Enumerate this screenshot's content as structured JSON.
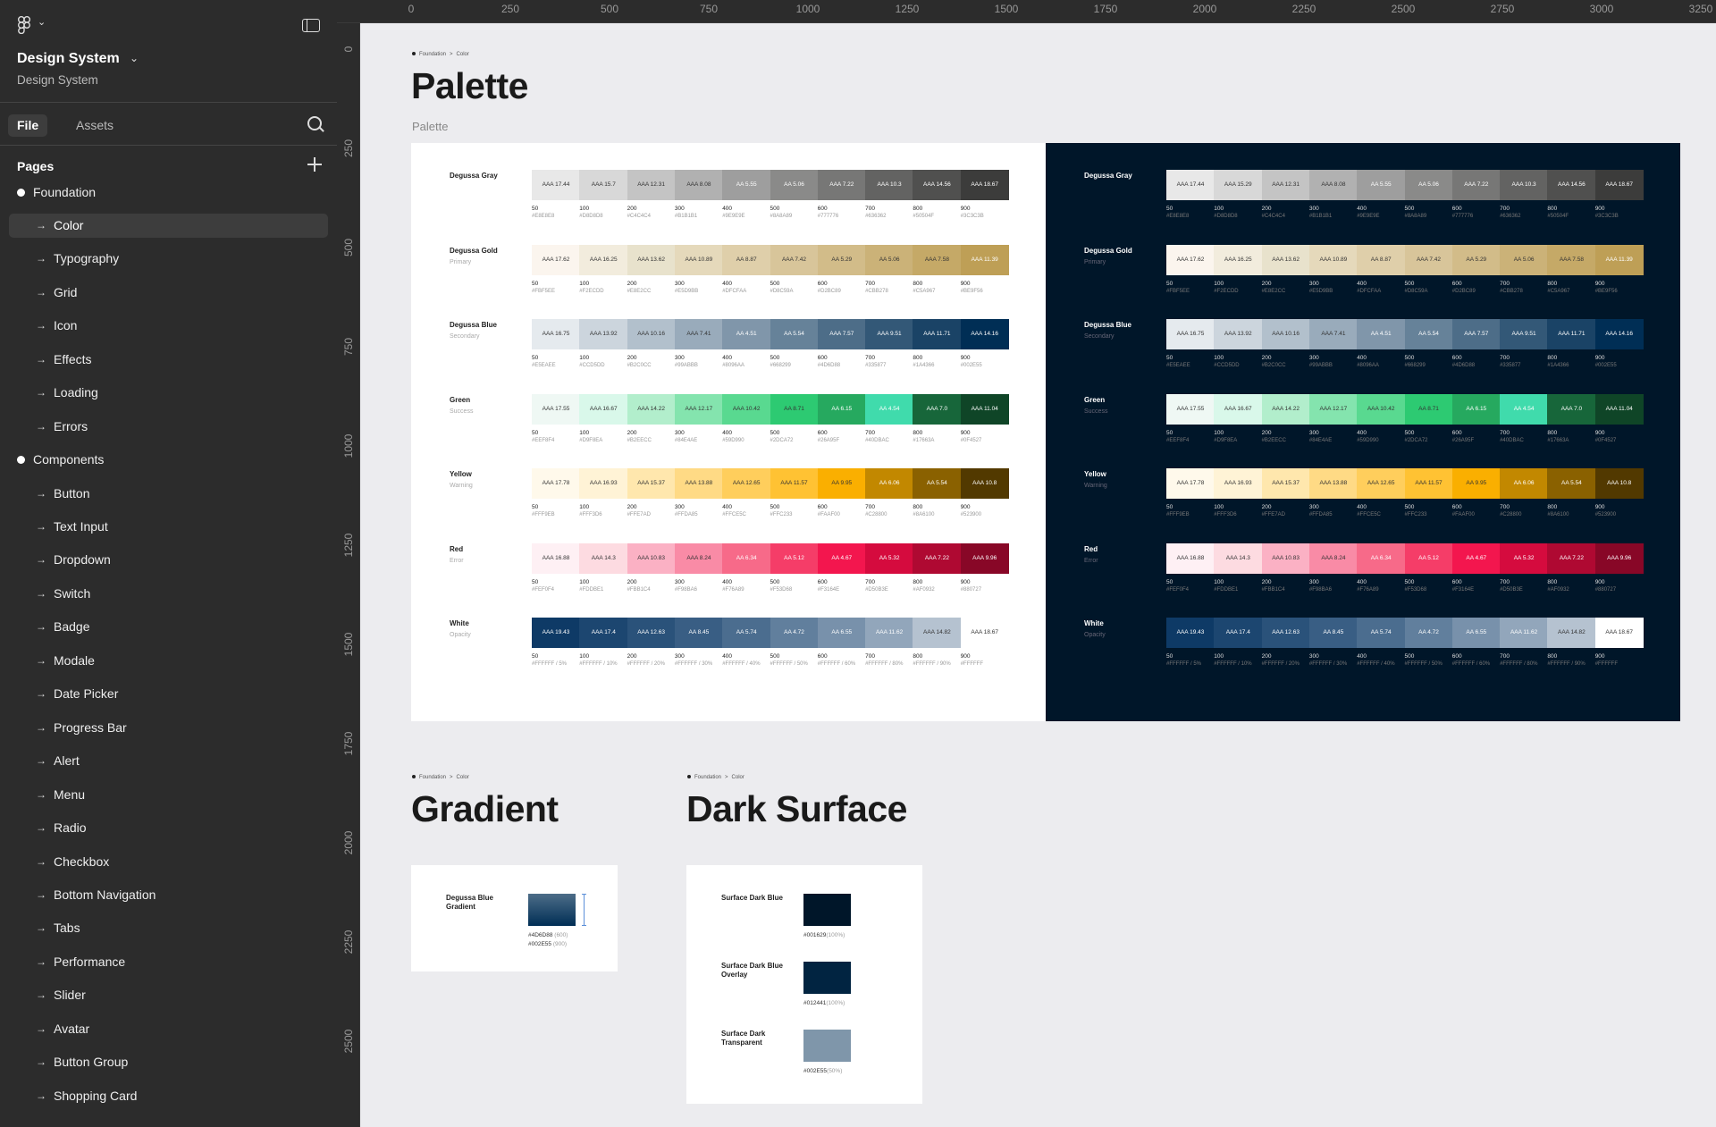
{
  "sidebar": {
    "file_title": "Design System",
    "file_subtitle": "Design System",
    "tabs": [
      "File",
      "Assets"
    ],
    "pages_heading": "Pages",
    "pages": [
      {
        "label": "Foundation",
        "type": "section"
      },
      {
        "label": "Color",
        "type": "page",
        "selected": true
      },
      {
        "label": "Typography",
        "type": "page"
      },
      {
        "label": "Grid",
        "type": "page"
      },
      {
        "label": "Icon",
        "type": "page"
      },
      {
        "label": "Effects",
        "type": "page"
      },
      {
        "label": "Loading",
        "type": "page"
      },
      {
        "label": "Errors",
        "type": "page"
      },
      {
        "label": "Components",
        "type": "section"
      },
      {
        "label": "Button",
        "type": "page"
      },
      {
        "label": "Text Input",
        "type": "page"
      },
      {
        "label": "Dropdown",
        "type": "page"
      },
      {
        "label": "Switch",
        "type": "page"
      },
      {
        "label": "Badge",
        "type": "page"
      },
      {
        "label": "Modale",
        "type": "page"
      },
      {
        "label": "Date Picker",
        "type": "page"
      },
      {
        "label": "Progress Bar",
        "type": "page"
      },
      {
        "label": "Alert",
        "type": "page"
      },
      {
        "label": "Menu",
        "type": "page"
      },
      {
        "label": "Radio",
        "type": "page"
      },
      {
        "label": "Checkbox",
        "type": "page"
      },
      {
        "label": "Bottom Navigation",
        "type": "page"
      },
      {
        "label": "Tabs",
        "type": "page"
      },
      {
        "label": "Performance",
        "type": "page"
      },
      {
        "label": "Slider",
        "type": "page"
      },
      {
        "label": "Avatar",
        "type": "page"
      },
      {
        "label": "Button Group",
        "type": "page"
      },
      {
        "label": "Shopping Card",
        "type": "page"
      }
    ]
  },
  "rulers": {
    "top": [
      "0",
      "250",
      "500",
      "750",
      "1000",
      "1250",
      "1500",
      "1750",
      "2000",
      "2250",
      "2500",
      "2750",
      "3000",
      "3250"
    ],
    "left": [
      "0",
      "250",
      "500",
      "750",
      "1000",
      "1250",
      "1500",
      "1750",
      "2000",
      "2250",
      "2500"
    ]
  },
  "breadcrumb": {
    "section": "Foundation",
    "page": "Color"
  },
  "palette_section": {
    "title": "Palette",
    "frame_label": "Palette"
  },
  "steps": [
    "50",
    "100",
    "200",
    "300",
    "400",
    "500",
    "600",
    "700",
    "800",
    "900"
  ],
  "palette_rows": [
    {
      "name": "Degussa Gray",
      "sub": "",
      "light": {
        "colors": [
          "#E8E8E8",
          "#D8D8D8",
          "#C4C4C4",
          "#B1B1B1",
          "#9E9E9E",
          "#8A8A89",
          "#777776",
          "#636362",
          "#50504F",
          "#3C3C3B"
        ],
        "labels": [
          "AAA 17.44",
          "AAA 15.7",
          "AAA 12.31",
          "AAA 8.08",
          "AA 5.55",
          "AA 5.06",
          "AAA 7.22",
          "AAA 10.3",
          "AAA 14.56",
          "AAA 18.67"
        ],
        "text_colors": [
          "#333",
          "#333",
          "#333",
          "#333",
          "#fff",
          "#fff",
          "#fff",
          "#fff",
          "#fff",
          "#fff"
        ],
        "hexes": [
          "#E8E8E8",
          "#D8D8D8",
          "#C4C4C4",
          "#B1B1B1",
          "#9E9E9E",
          "#8A8A89",
          "#777776",
          "#636362",
          "#50504F",
          "#3C3C3B"
        ]
      },
      "dark": {
        "colors": [
          "#E8E8E8",
          "#D8D8D8",
          "#C4C4C4",
          "#B1B1B1",
          "#9E9E9E",
          "#8A8A89",
          "#777776",
          "#636362",
          "#50504F",
          "#3C3C3B"
        ],
        "labels": [
          "AAA 17.44",
          "AAA 15.29",
          "AAA 12.31",
          "AAA 8.08",
          "AA 5.55",
          "AA 5.06",
          "AAA 7.22",
          "AAA 10.3",
          "AAA 14.56",
          "AAA 18.67"
        ],
        "text_colors": [
          "#333",
          "#333",
          "#333",
          "#333",
          "#fff",
          "#fff",
          "#fff",
          "#fff",
          "#fff",
          "#fff"
        ],
        "hexes": [
          "#E8E8E8",
          "#D8D8D8",
          "#C4C4C4",
          "#B1B1B1",
          "#9E9E9E",
          "#8A8A89",
          "#777776",
          "#636362",
          "#50504F",
          "#3C3C3B"
        ]
      }
    },
    {
      "name": "Degussa Gold",
      "sub": "Primary",
      "light": {
        "colors": [
          "#FBF5EE",
          "#F2ECDD",
          "#E8E2CC",
          "#E5D9BB",
          "#DFCFAA",
          "#D8C59A",
          "#D2BC89",
          "#CBB278",
          "#C5A967",
          "#BE9F56"
        ],
        "labels": [
          "AAA 17.62",
          "AAA 16.25",
          "AAA 13.62",
          "AAA 10.89",
          "AA 8.87",
          "AAA 7.42",
          "AA 5.29",
          "AA 5.06",
          "AAA 7.58",
          "AAA 11.39"
        ],
        "text_colors": [
          "#333",
          "#333",
          "#333",
          "#333",
          "#333",
          "#333",
          "#333",
          "#333",
          "#333",
          "#fff"
        ],
        "hexes": [
          "#FBF5EE",
          "#F2ECDD",
          "#E8E2CC",
          "#E5D9BB",
          "#DFCFAA",
          "#D8C59A",
          "#D2BC89",
          "#CBB278",
          "#C5A967",
          "#BE9F56"
        ]
      },
      "dark": {
        "colors": [
          "#FBF5EE",
          "#F2ECDD",
          "#E8E2CC",
          "#E5D9BB",
          "#DFCFAA",
          "#D8C59A",
          "#D2BC89",
          "#CBB278",
          "#C5A967",
          "#BE9F56"
        ],
        "labels": [
          "AAA 17.62",
          "AAA 16.25",
          "AAA 13.62",
          "AAA 10.89",
          "AA 8.87",
          "AAA 7.42",
          "AA 5.29",
          "AA 5.06",
          "AAA 7.58",
          "AAA 11.39"
        ],
        "text_colors": [
          "#333",
          "#333",
          "#333",
          "#333",
          "#333",
          "#333",
          "#333",
          "#333",
          "#333",
          "#fff"
        ],
        "hexes": [
          "#FBF5EE",
          "#F2ECDD",
          "#E8E2CC",
          "#E5D9BB",
          "#DFCFAA",
          "#D8C59A",
          "#D2BC89",
          "#CBB278",
          "#C5A967",
          "#BE9F56"
        ]
      }
    },
    {
      "name": "Degussa Blue",
      "sub": "Secondary",
      "light": {
        "colors": [
          "#E5EAEE",
          "#CCD5DD",
          "#B2C0CC",
          "#99ABBB",
          "#8096AA",
          "#668299",
          "#4D6D88",
          "#335877",
          "#1A4366",
          "#002E55"
        ],
        "labels": [
          "AAA 16.75",
          "AAA 13.92",
          "AAA 10.16",
          "AAA 7.41",
          "AA 4.51",
          "AA 5.54",
          "AAA 7.57",
          "AAA 9.51",
          "AAA 11.71",
          "AAA 14.16"
        ],
        "text_colors": [
          "#333",
          "#333",
          "#333",
          "#333",
          "#fff",
          "#fff",
          "#fff",
          "#fff",
          "#fff",
          "#fff"
        ],
        "hexes": [
          "#E5EAEE",
          "#CCD5DD",
          "#B2C0CC",
          "#99ABBB",
          "#8096AA",
          "#668299",
          "#4D6D88",
          "#335877",
          "#1A4366",
          "#002E55"
        ]
      },
      "dark": {
        "colors": [
          "#E5EAEE",
          "#CCD5DD",
          "#B2C0CC",
          "#99ABBB",
          "#8096AA",
          "#668299",
          "#4D6D88",
          "#335877",
          "#1A4366",
          "#002E55"
        ],
        "labels": [
          "AAA 16.75",
          "AAA 13.92",
          "AAA 10.16",
          "AAA 7.41",
          "AA 4.51",
          "AA 5.54",
          "AAA 7.57",
          "AAA 9.51",
          "AAA 11.71",
          "AAA 14.16"
        ],
        "text_colors": [
          "#333",
          "#333",
          "#333",
          "#333",
          "#fff",
          "#fff",
          "#fff",
          "#fff",
          "#fff",
          "#fff"
        ],
        "hexes": [
          "#E5EAEE",
          "#CCD5DD",
          "#B2C0CC",
          "#99ABBB",
          "#8096AA",
          "#668299",
          "#4D6D88",
          "#335877",
          "#1A4366",
          "#002E55"
        ]
      }
    },
    {
      "name": "Green",
      "sub": "Success",
      "light": {
        "colors": [
          "#EFF8F4",
          "#D9F8EA",
          "#B2EECC",
          "#84E4AE",
          "#59D990",
          "#2DCA72",
          "#26A95F",
          "#40DBAC",
          "#17663A",
          "#0F4527"
        ],
        "labels": [
          "AAA 17.55",
          "AAA 16.67",
          "AAA 14.22",
          "AAA 12.17",
          "AAA 10.42",
          "AA 8.71",
          "AA 6.15",
          "AA 4.54",
          "AAA 7.0",
          "AAA 11.04"
        ],
        "text_colors": [
          "#333",
          "#333",
          "#333",
          "#333",
          "#333",
          "#333",
          "#fff",
          "#fff",
          "#fff",
          "#fff"
        ],
        "hexes": [
          "#EEF8F4",
          "#D9F8EA",
          "#B2EECC",
          "#84E4AE",
          "#59D990",
          "#2DCA72",
          "#26A95F",
          "#40DBAC",
          "#17663A",
          "#0F4527"
        ]
      },
      "dark": {
        "colors": [
          "#EFF8F4",
          "#D9F8EA",
          "#B2EECC",
          "#84E4AE",
          "#59D990",
          "#2DCA72",
          "#26A95F",
          "#40DBAC",
          "#17663A",
          "#0F4527"
        ],
        "labels": [
          "AAA 17.55",
          "AAA 16.67",
          "AAA 14.22",
          "AAA 12.17",
          "AAA 10.42",
          "AA 8.71",
          "AA 6.15",
          "AA 4.54",
          "AAA 7.0",
          "AAA 11.04"
        ],
        "text_colors": [
          "#333",
          "#333",
          "#333",
          "#333",
          "#333",
          "#333",
          "#fff",
          "#fff",
          "#fff",
          "#fff"
        ],
        "hexes": [
          "#EEF8F4",
          "#D9F8EA",
          "#B2EECC",
          "#84E4AE",
          "#59D990",
          "#2DCA72",
          "#26A95F",
          "#40DBAC",
          "#17663A",
          "#0F4527"
        ]
      }
    },
    {
      "name": "Yellow",
      "sub": "Warning",
      "light": {
        "colors": [
          "#FFF9EB",
          "#FFF3D6",
          "#FFE7AD",
          "#FFDA85",
          "#FFCE5C",
          "#FFC233",
          "#FAAF00",
          "#C28800",
          "#8A6100",
          "#523900"
        ],
        "labels": [
          "AAA 17.78",
          "AAA 16.93",
          "AAA 15.37",
          "AAA 13.88",
          "AAA 12.65",
          "AAA 11.57",
          "AA 9.95",
          "AA 6.06",
          "AA 5.54",
          "AAA 10.8"
        ],
        "text_colors": [
          "#333",
          "#333",
          "#333",
          "#333",
          "#333",
          "#333",
          "#333",
          "#fff",
          "#fff",
          "#fff"
        ],
        "hexes": [
          "#FFF9EB",
          "#FFF3D6",
          "#FFE7AD",
          "#FFDA85",
          "#FFCE5C",
          "#FFC233",
          "#FAAF00",
          "#C28800",
          "#8A6100",
          "#523900"
        ]
      },
      "dark": {
        "colors": [
          "#FFF9EB",
          "#FFF3D6",
          "#FFE7AD",
          "#FFDA85",
          "#FFCE5C",
          "#FFC233",
          "#FAAF00",
          "#C28800",
          "#8A6100",
          "#523900"
        ],
        "labels": [
          "AAA 17.78",
          "AAA 16.93",
          "AAA 15.37",
          "AAA 13.88",
          "AAA 12.65",
          "AAA 11.57",
          "AA 9.95",
          "AA 6.06",
          "AA 5.54",
          "AAA 10.8"
        ],
        "text_colors": [
          "#333",
          "#333",
          "#333",
          "#333",
          "#333",
          "#333",
          "#333",
          "#fff",
          "#fff",
          "#fff"
        ],
        "hexes": [
          "#FFF9EB",
          "#FFF3D6",
          "#FFE7AD",
          "#FFDA85",
          "#FFCE5C",
          "#FFC233",
          "#FAAF00",
          "#C28800",
          "#8A6100",
          "#523900"
        ]
      }
    },
    {
      "name": "Red",
      "sub": "Error",
      "light": {
        "colors": [
          "#FEF0F4",
          "#FDDBE1",
          "#FBB1C4",
          "#F98BA6",
          "#F76A89",
          "#F53D68",
          "#F3164E",
          "#D50B3E",
          "#AF0932",
          "#880727"
        ],
        "labels": [
          "AAA 16.88",
          "AAA 14.3",
          "AAA 10.83",
          "AAA 8.24",
          "AA 6.34",
          "AA 5.12",
          "AA 4.67",
          "AA 5.32",
          "AAA 7.22",
          "AAA 9.96"
        ],
        "text_colors": [
          "#333",
          "#333",
          "#333",
          "#333",
          "#fff",
          "#fff",
          "#fff",
          "#fff",
          "#fff",
          "#fff"
        ],
        "hexes": [
          "#FEF0F4",
          "#FDDBE1",
          "#FBB1C4",
          "#F98BA6",
          "#F76A89",
          "#F53D68",
          "#F3164E",
          "#D50B3E",
          "#AF0932",
          "#880727"
        ]
      },
      "dark": {
        "colors": [
          "#FEF0F4",
          "#FDDBE1",
          "#FBB1C4",
          "#F98BA6",
          "#F76A89",
          "#F53D68",
          "#F3164E",
          "#D50B3E",
          "#AF0932",
          "#880727"
        ],
        "labels": [
          "AAA 16.88",
          "AAA 14.3",
          "AAA 10.83",
          "AAA 8.24",
          "AA 6.34",
          "AA 5.12",
          "AA 4.67",
          "AA 5.32",
          "AAA 7.22",
          "AAA 9.96"
        ],
        "text_colors": [
          "#333",
          "#333",
          "#333",
          "#333",
          "#fff",
          "#fff",
          "#fff",
          "#fff",
          "#fff",
          "#fff"
        ],
        "hexes": [
          "#FEF0F4",
          "#FDDBE1",
          "#FBB1C4",
          "#F98BA6",
          "#F76A89",
          "#F53D68",
          "#F3164E",
          "#D50B3E",
          "#AF0932",
          "#880727"
        ]
      }
    },
    {
      "name": "White",
      "sub": "Opacity",
      "light": {
        "colors": [
          "#0E3A66",
          "#1C4670",
          "#2A527A",
          "#395E84",
          "#4B6D8F",
          "#617F9D",
          "#7891AB",
          "#92A6BB",
          "#B5C2D0",
          "#FFFFFF"
        ],
        "labels": [
          "AAA 19.43",
          "AAA 17.4",
          "AAA 12.63",
          "AA 8.45",
          "AA 5.74",
          "AA 4.72",
          "AA 6.55",
          "AAA 11.62",
          "AAA 14.82",
          "AAA 18.67"
        ],
        "text_colors": [
          "#fff",
          "#fff",
          "#fff",
          "#fff",
          "#fff",
          "#fff",
          "#fff",
          "#fff",
          "#333",
          "#333"
        ],
        "hexes": [
          "#FFFFFF / 5%",
          "#FFFFFF / 10%",
          "#FFFFFF / 20%",
          "#FFFFFF / 30%",
          "#FFFFFF / 40%",
          "#FFFFFF / 50%",
          "#FFFFFF / 60%",
          "#FFFFFF / 80%",
          "#FFFFFF / 90%",
          "#FFFFFF"
        ]
      },
      "dark": {
        "colors": [
          "#0E3A66",
          "#1C4670",
          "#2A527A",
          "#395E84",
          "#4B6D8F",
          "#617F9D",
          "#7891AB",
          "#92A6BB",
          "#B5C2D0",
          "#FFFFFF"
        ],
        "labels": [
          "AAA 19.43",
          "AAA 17.4",
          "AAA 12.63",
          "AA 8.45",
          "AA 5.74",
          "AA 4.72",
          "AA 6.55",
          "AAA 11.62",
          "AAA 14.82",
          "AAA 18.67"
        ],
        "text_colors": [
          "#fff",
          "#fff",
          "#fff",
          "#fff",
          "#fff",
          "#fff",
          "#fff",
          "#fff",
          "#333",
          "#333"
        ],
        "hexes": [
          "#FFFFFF / 5%",
          "#FFFFFF / 10%",
          "#FFFFFF / 20%",
          "#FFFFFF / 30%",
          "#FFFFFF / 40%",
          "#FFFFFF / 50%",
          "#FFFFFF / 60%",
          "#FFFFFF / 80%",
          "#FFFFFF / 90%",
          "#FFFFFF"
        ]
      }
    }
  ],
  "gradient_section": {
    "title": "Gradient",
    "item_name": "Degussa Blue Gradient",
    "stop1_hex": "#4D6D88",
    "stop1_step": "(600)",
    "stop2_hex": "#002E55",
    "stop2_step": "(900)",
    "color_from": "#4D6D88",
    "color_to": "#002E55"
  },
  "dark_surface_section": {
    "title": "Dark Surface",
    "items": [
      {
        "name": "Surface Dark Blue",
        "hex": "#001629",
        "pct": "(100%)",
        "color": "#001629"
      },
      {
        "name": "Surface Dark Blue Overlay",
        "hex": "#012441",
        "pct": "(100%)",
        "color": "#012441"
      },
      {
        "name": "Surface Dark Transparent",
        "hex": "#002E55",
        "pct": "(50%)",
        "color": "#7F96AA"
      }
    ]
  }
}
